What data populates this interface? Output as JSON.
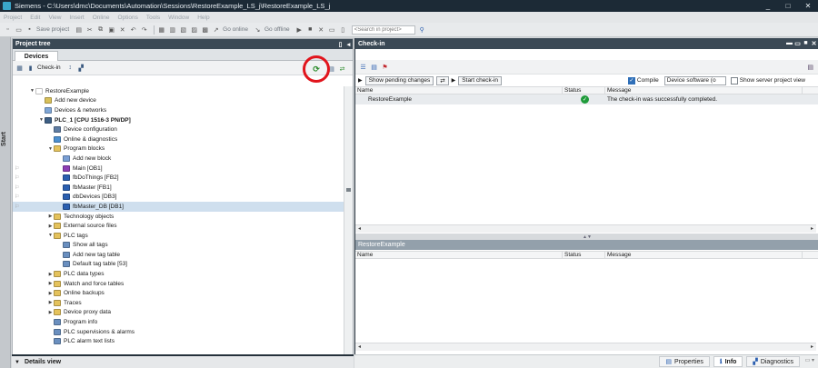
{
  "window": {
    "title": "Siemens  -  C:\\Users\\dmc\\Documents\\Automation\\Sessions\\RestoreExample_LS_j\\RestoreExample_LS_j",
    "controls": [
      "_",
      "□",
      "✕"
    ]
  },
  "menu": [
    "Project",
    "Edit",
    "View",
    "Insert",
    "Online",
    "Options",
    "Tools",
    "Window",
    "Help"
  ],
  "toolbar": {
    "save_label": "Save project",
    "go_online": "Go online",
    "go_offline": "Go offline",
    "search_placeholder": "<Search in project>"
  },
  "start_tab": "Start",
  "project_tree": {
    "title": "Project tree",
    "tab": "Devices",
    "checkin_label": "Check-in",
    "items": [
      {
        "label": "RestoreExample",
        "indent": 0,
        "exp": "▼",
        "icon": "#ffffff"
      },
      {
        "label": "Add new device",
        "indent": 1,
        "exp": "",
        "icon": "#d8c05a"
      },
      {
        "label": "Devices & networks",
        "indent": 1,
        "exp": "",
        "icon": "#7fa6d6"
      },
      {
        "label": "PLC_1 [CPU 1516-3 PN/DP]",
        "indent": 1,
        "exp": "▼",
        "icon": "#3e5f84",
        "bold": true
      },
      {
        "label": "Device configuration",
        "indent": 2,
        "exp": "",
        "icon": "#5f7da3"
      },
      {
        "label": "Online & diagnostics",
        "indent": 2,
        "exp": "",
        "icon": "#4d8fcf"
      },
      {
        "label": "Program blocks",
        "indent": 2,
        "exp": "▼",
        "icon": "#e4c25c"
      },
      {
        "label": "Add new block",
        "indent": 3,
        "exp": "",
        "icon": "#7a9fd4"
      },
      {
        "label": "Main [OB1]",
        "indent": 3,
        "exp": "",
        "icon": "#8e3fb5",
        "flag": true
      },
      {
        "label": "fbDoThings [FB2]",
        "indent": 3,
        "exp": "",
        "icon": "#2b5fb0",
        "flag": true
      },
      {
        "label": "fbMaster [FB1]",
        "indent": 3,
        "exp": "",
        "icon": "#2b5fb0",
        "flag": true
      },
      {
        "label": "dbDevices [DB3]",
        "indent": 3,
        "exp": "",
        "icon": "#2b5fb0",
        "flag": true
      },
      {
        "label": "fbMaster_DB [DB1]",
        "indent": 3,
        "exp": "",
        "icon": "#2b5fb0",
        "flag": true,
        "selected": true
      },
      {
        "label": "Technology objects",
        "indent": 2,
        "exp": "▶",
        "icon": "#e4c25c"
      },
      {
        "label": "External source files",
        "indent": 2,
        "exp": "▶",
        "icon": "#e4c25c"
      },
      {
        "label": "PLC tags",
        "indent": 2,
        "exp": "▼",
        "icon": "#e4c25c"
      },
      {
        "label": "Show all tags",
        "indent": 3,
        "exp": "",
        "icon": "#6a8fbf"
      },
      {
        "label": "Add new tag table",
        "indent": 3,
        "exp": "",
        "icon": "#6a8fbf"
      },
      {
        "label": "Default tag table [53]",
        "indent": 3,
        "exp": "",
        "icon": "#6a8fbf"
      },
      {
        "label": "PLC data types",
        "indent": 2,
        "exp": "▶",
        "icon": "#e4c25c"
      },
      {
        "label": "Watch and force tables",
        "indent": 2,
        "exp": "▶",
        "icon": "#e4c25c"
      },
      {
        "label": "Online backups",
        "indent": 2,
        "exp": "▶",
        "icon": "#e4c25c"
      },
      {
        "label": "Traces",
        "indent": 2,
        "exp": "▶",
        "icon": "#e4c25c"
      },
      {
        "label": "Device proxy data",
        "indent": 2,
        "exp": "▶",
        "icon": "#e4c25c"
      },
      {
        "label": "Program info",
        "indent": 2,
        "exp": "",
        "icon": "#6a8fbf"
      },
      {
        "label": "PLC supervisions & alarms",
        "indent": 2,
        "exp": "",
        "icon": "#6a8fbf"
      },
      {
        "label": "PLC alarm text lists",
        "indent": 2,
        "exp": "",
        "icon": "#6a8fbf"
      }
    ]
  },
  "details_view": "Details view",
  "checkin": {
    "title": "Check-in",
    "show_pending": "Show pending changes",
    "start_checkin": "Start check-in",
    "compile_label": "Compile",
    "compile_checked": true,
    "compile_mode": "Device software (o",
    "show_server_view": "Show server project view",
    "columns": {
      "name": "Name",
      "status": "Status",
      "message": "Message"
    },
    "rows": [
      {
        "name": "RestoreExample",
        "status": "ok",
        "message": "The check-in was successfully completed."
      }
    ],
    "sub_title": "RestoreExample",
    "sub_columns": {
      "name": "Name",
      "status": "Status",
      "message": "Message"
    }
  },
  "bottom_tabs": [
    {
      "label": "Properties",
      "icon": "properties-icon",
      "active": false
    },
    {
      "label": "Info",
      "icon": "info-icon",
      "active": true
    },
    {
      "label": "Diagnostics",
      "icon": "diagnostics-icon",
      "active": false
    }
  ],
  "colors": {
    "highlight_ring": "#e1141c",
    "title_bar": "#1c2a36",
    "pane_header": "#3b4955",
    "status_ok": "#1f9b3a",
    "selected_row": "#cfdfee"
  }
}
